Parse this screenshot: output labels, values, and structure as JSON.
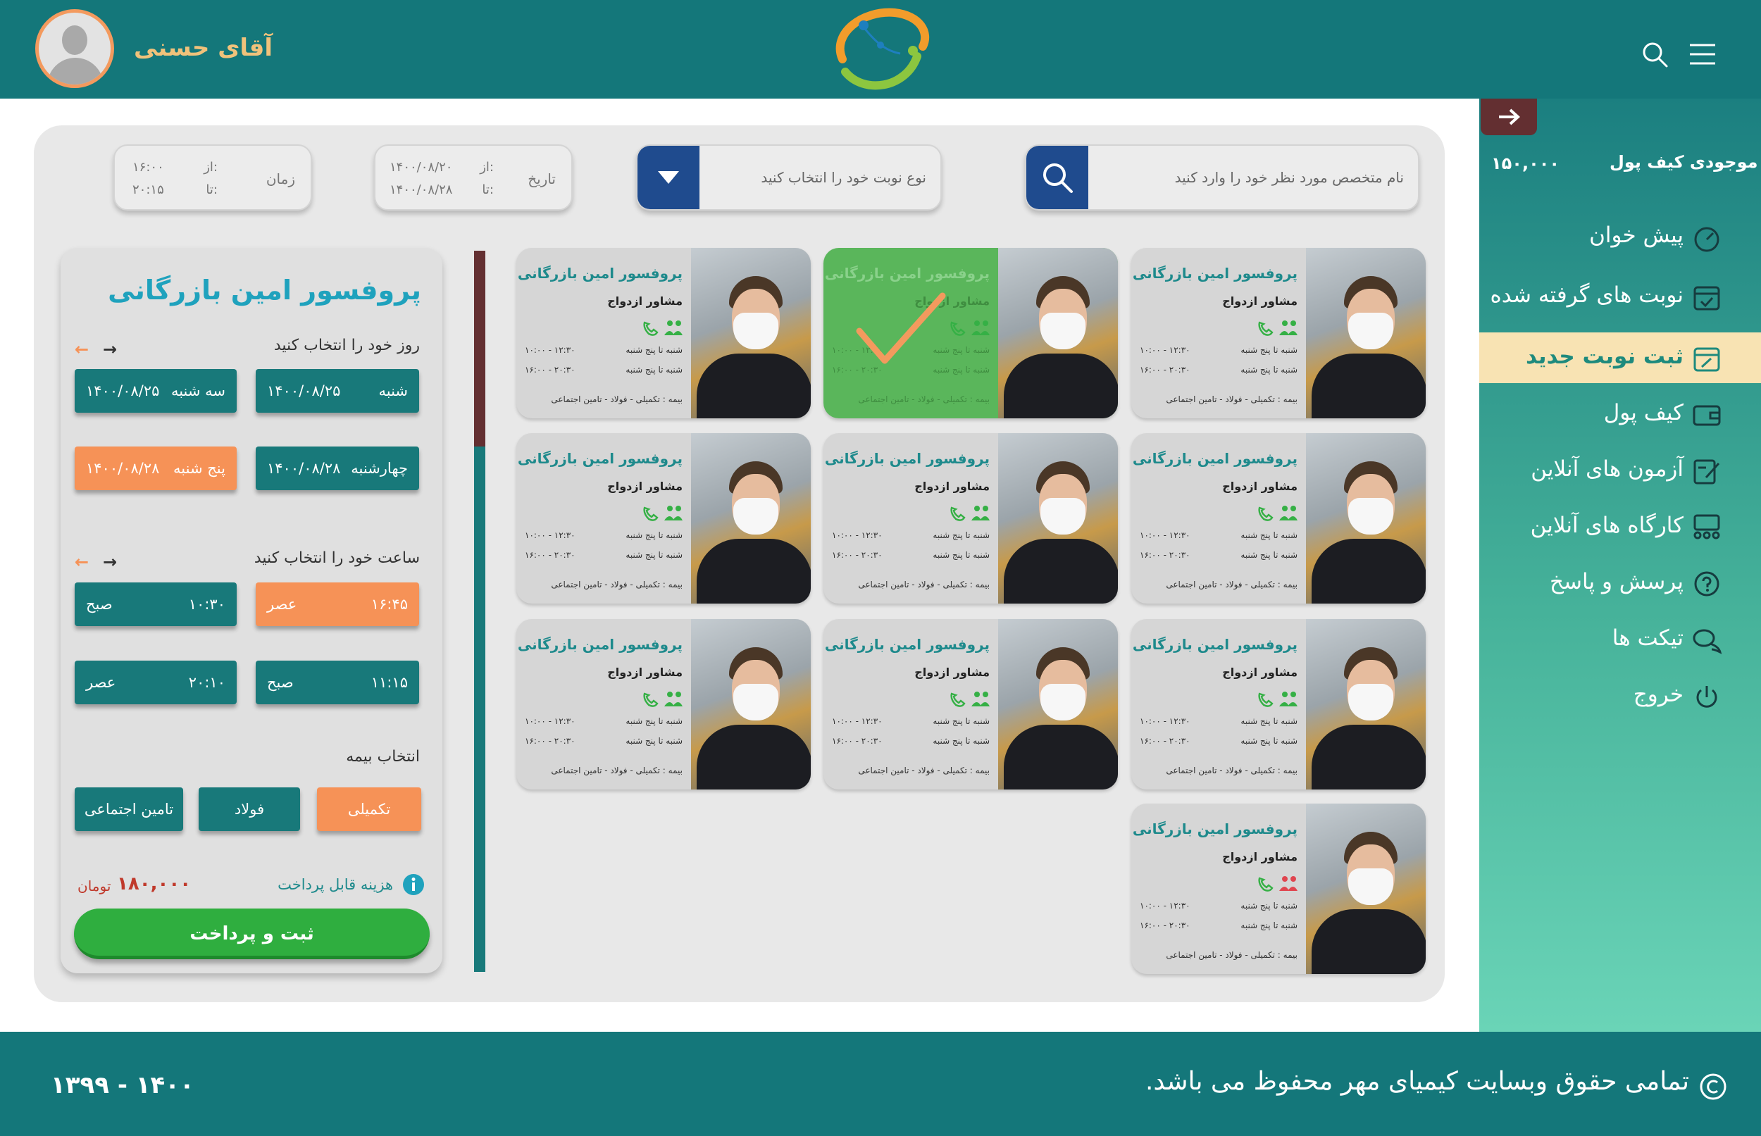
{
  "header": {
    "user_name": "آقای حسنی"
  },
  "wallet": {
    "label": "موجودی کیف پول",
    "balance": "۱۵۰,۰۰۰"
  },
  "nav": [
    {
      "label": "پیش خوان",
      "icon": "dashboard-icon"
    },
    {
      "label": "نوبت های گرفته شده",
      "icon": "calendar-check-icon"
    },
    {
      "label": "ثبت نوبت جدید",
      "icon": "calendar-edit-icon",
      "active": true
    },
    {
      "label": "کیف پول",
      "icon": "wallet-icon"
    },
    {
      "label": "آزمون های آنلاین",
      "icon": "exam-edit-icon"
    },
    {
      "label": "کارگاه های آنلاین",
      "icon": "workshop-group-icon"
    },
    {
      "label": "پرسش و پاسخ",
      "icon": "question-icon"
    },
    {
      "label": "تیکت ها",
      "icon": "chat-icon"
    },
    {
      "label": "خروج",
      "icon": "power-icon"
    }
  ],
  "filters": {
    "search_placeholder": "نام متخصص مورد نظر خود را وارد کنید",
    "type_placeholder": "نوع نوبت خود را انتخاب کنید",
    "date_label": "تاریخ",
    "date_from_label": "از:",
    "date_to_label": "تا:",
    "date_from": "۱۴۰۰/۰۸/۲۰",
    "date_to": "۱۴۰۰/۰۸/۲۸",
    "time_label": "زمان",
    "time_from_label": "از:",
    "time_to_label": "تا:",
    "time_from": "۱۶:۰۰",
    "time_to": "۲۰:۱۵"
  },
  "detail": {
    "name": "پروفسور امین بازرگانی",
    "day_label": "روز خود را انتخاب کنید",
    "days": [
      {
        "day": "شنبه",
        "date": "۱۴۰۰/۰۸/۲۵",
        "selected": false
      },
      {
        "day": "سه شنبه",
        "date": "۱۴۰۰/۰۸/۲۵",
        "selected": false
      },
      {
        "day": "چهارشنبه",
        "date": "۱۴۰۰/۰۸/۲۸",
        "selected": false
      },
      {
        "day": "پنج شنبه",
        "date": "۱۴۰۰/۰۸/۲۸",
        "selected": true
      }
    ],
    "time_label": "ساعت خود را انتخاب کنید",
    "times": [
      {
        "time": "۱۶:۴۵",
        "period": "عصر",
        "selected": true
      },
      {
        "time": "۱۰:۳۰",
        "period": "صبح",
        "selected": false
      },
      {
        "time": "۱۱:۱۵",
        "period": "صبح",
        "selected": false
      },
      {
        "time": "۲۰:۱۰",
        "period": "عصر",
        "selected": false
      }
    ],
    "insurance_label": "انتخاب بیمه",
    "insurances": [
      {
        "name": "تکمیلی",
        "selected": true
      },
      {
        "name": "فولاد",
        "selected": false
      },
      {
        "name": "تامین اجتماعی",
        "selected": false
      }
    ],
    "cost_label": "هزینه قابل پرداخت",
    "cost_value": "۱۸۰,۰۰۰",
    "cost_unit": "تومان",
    "pay_label": "ثبت و پرداخت"
  },
  "cards": [
    {
      "name": "پروفسور امین بازرگانی",
      "role": "مشاور ازدواج",
      "days1": "شنبه تا پنج شنبه",
      "time1": "۱۰:۰۰ - ۱۲:۳۰",
      "days2": "شنبه تا پنج شنبه",
      "time2": "۱۶:۰۰ - ۲۰:۳۰",
      "insurance": "بیمه : تکمیلی - فولاد - تامین اجتماعی",
      "selected": false,
      "group_color": "#35b045"
    },
    {
      "name": "پروفسور امین بازرگانی",
      "role": "مشاور ازدواج",
      "days1": "شنبه تا پنج شنبه",
      "time1": "۱۰:۰۰ - ۱۲:۳۰",
      "days2": "شنبه تا پنج شنبه",
      "time2": "۱۶:۰۰ - ۲۰:۳۰",
      "insurance": "بیمه : تکمیلی - فولاد - تامین اجتماعی",
      "selected": true,
      "group_color": "#35b045"
    },
    {
      "name": "پروفسور امین بازرگانی",
      "role": "مشاور ازدواج",
      "days1": "شنبه تا پنج شنبه",
      "time1": "۱۰:۰۰ - ۱۲:۳۰",
      "days2": "شنبه تا پنج شنبه",
      "time2": "۱۶:۰۰ - ۲۰:۳۰",
      "insurance": "بیمه : تکمیلی - فولاد - تامین اجتماعی",
      "selected": false,
      "group_color": "#35b045"
    },
    {
      "name": "پروفسور امین بازرگانی",
      "role": "مشاور ازدواج",
      "days1": "شنبه تا پنج شنبه",
      "time1": "۱۰:۰۰ - ۱۲:۳۰",
      "days2": "شنبه تا پنج شنبه",
      "time2": "۱۶:۰۰ - ۲۰:۳۰",
      "insurance": "بیمه : تکمیلی - فولاد - تامین اجتماعی",
      "selected": false,
      "group_color": "#35b045"
    },
    {
      "name": "پروفسور امین بازرگانی",
      "role": "مشاور ازدواج",
      "days1": "شنبه تا پنج شنبه",
      "time1": "۱۰:۰۰ - ۱۲:۳۰",
      "days2": "شنبه تا پنج شنبه",
      "time2": "۱۶:۰۰ - ۲۰:۳۰",
      "insurance": "بیمه : تکمیلی - فولاد - تامین اجتماعی",
      "selected": false,
      "group_color": "#35b045"
    },
    {
      "name": "پروفسور امین بازرگانی",
      "role": "مشاور ازدواج",
      "days1": "شنبه تا پنج شنبه",
      "time1": "۱۰:۰۰ - ۱۲:۳۰",
      "days2": "شنبه تا پنج شنبه",
      "time2": "۱۶:۰۰ - ۲۰:۳۰",
      "insurance": "بیمه : تکمیلی - فولاد - تامین اجتماعی",
      "selected": false,
      "group_color": "#35b045"
    },
    {
      "name": "پروفسور امین بازرگانی",
      "role": "مشاور ازدواج",
      "days1": "شنبه تا پنج شنبه",
      "time1": "۱۰:۰۰ - ۱۲:۳۰",
      "days2": "شنبه تا پنج شنبه",
      "time2": "۱۶:۰۰ - ۲۰:۳۰",
      "insurance": "بیمه : تکمیلی - فولاد - تامین اجتماعی",
      "selected": false,
      "group_color": "#35b045"
    },
    {
      "name": "پروفسور امین بازرگانی",
      "role": "مشاور ازدواج",
      "days1": "شنبه تا پنج شنبه",
      "time1": "۱۰:۰۰ - ۱۲:۳۰",
      "days2": "شنبه تا پنج شنبه",
      "time2": "۱۶:۰۰ - ۲۰:۳۰",
      "insurance": "بیمه : تکمیلی - فولاد - تامین اجتماعی",
      "selected": false,
      "group_color": "#35b045"
    },
    {
      "name": "پروفسور امین بازرگانی",
      "role": "مشاور ازدواج",
      "days1": "شنبه تا پنج شنبه",
      "time1": "۱۰:۰۰ - ۱۲:۳۰",
      "days2": "شنبه تا پنج شنبه",
      "time2": "۱۶:۰۰ - ۲۰:۳۰",
      "insurance": "بیمه : تکمیلی - فولاد - تامین اجتماعی",
      "selected": false,
      "group_color": "#35b045"
    },
    {
      "name": "پروفسور امین بازرگانی",
      "role": "مشاور ازدواج",
      "days1": "شنبه تا پنج شنبه",
      "time1": "۱۰:۰۰ - ۱۲:۳۰",
      "days2": "شنبه تا پنج شنبه",
      "time2": "۱۶:۰۰ - ۲۰:۳۰",
      "insurance": "بیمه : تکمیلی - فولاد - تامین اجتماعی",
      "selected": false,
      "group_color": "#e0454f"
    }
  ],
  "footer": {
    "copyright": "تمامی حقوق وبسایت کیمیای مهر محفوظ می باشد.",
    "years": "۱۳۹۹ - ۱۴۰۰"
  },
  "colors": {
    "primary": "#14777a",
    "accent_orange": "#f69257",
    "pay_green": "#2fae3f",
    "search_blue": "#1f4b8e",
    "scroll_thumb": "#632f31",
    "active_nav_bg": "#f8e3b3",
    "name_cyan": "#1fa2bd"
  }
}
